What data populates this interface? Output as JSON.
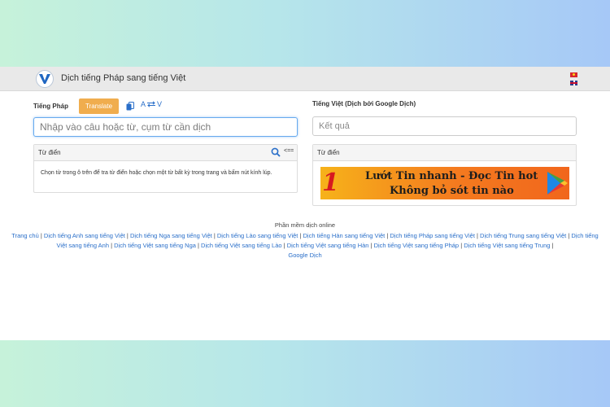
{
  "header": {
    "site_title": "Dịch tiếng Pháp sang tiếng Việt",
    "flags": [
      "vietnamese-flag",
      "english-flag"
    ]
  },
  "source": {
    "language_label": "Tiếng Pháp",
    "translate_label": "Translate",
    "swap_label_from": "A",
    "swap_label_to": "V",
    "input_placeholder": "Nhập vào câu hoặc từ, cụm từ cần dịch",
    "input_value": ""
  },
  "target": {
    "language_label": "Tiếng Việt (Dịch bởi Google Dịch)",
    "result_text": "Kết quả"
  },
  "dictionary": {
    "title": "Từ điển",
    "arrow_label": "<==",
    "help_text": "Chọn từ trong ô trên để tra từ điển hoặc chọn một từ bất kỳ trong trang và bấm nút kính lúp."
  },
  "right_panel": {
    "title": "Từ điển",
    "banner_logo": "1",
    "banner_line1": "Lướt Tin nhanh - Đọc Tin hot",
    "banner_line2": "Không bỏ sót tin nào"
  },
  "footer": {
    "heading": "Phần mềm dịch online",
    "links": [
      "Trang chủ",
      "Dịch tiếng Anh sang tiếng Việt",
      "Dịch tiếng Nga sang tiếng Việt",
      "Dịch tiếng Lào sang tiếng Việt",
      "Dịch tiếng Hàn sang tiếng Việt",
      "Dịch tiếng Pháp sang tiếng Việt",
      "Dịch tiếng Trung sang tiếng Việt",
      "Dịch tiếng Việt sang tiếng Anh",
      "Dịch tiếng Việt sang tiếng Nga",
      "Dịch tiếng Việt sang tiếng Lào",
      "Dịch tiếng Việt sang tiếng Hàn",
      "Dịch tiếng Việt sang tiếng Pháp",
      "Dịch tiếng Việt sang tiếng Trung",
      "Google Dịch"
    ]
  },
  "colors": {
    "accent_orange": "#f0ad4e",
    "link_blue": "#2a6fc9",
    "input_focus": "#66a9ee"
  }
}
